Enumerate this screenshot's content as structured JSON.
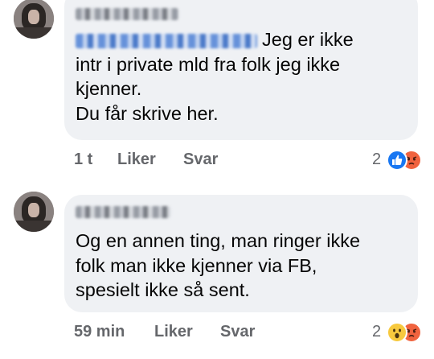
{
  "comments": [
    {
      "author": "Siv Stålberg",
      "mention": "Kaysh Anne Knestad",
      "lines": [
        "Jeg er ikke",
        "intr i private mld fra folk jeg ikke",
        "kjenner.",
        "Du får skrive her."
      ],
      "time": "1 t",
      "like_label": "Liker",
      "reply_label": "Svar",
      "reaction_count": "2",
      "reactions": [
        "like-icon",
        "angry-icon"
      ],
      "reaction_colors": {
        "like": "#1877f2",
        "angry": "#f0633f"
      }
    },
    {
      "author": "Siv Stålberg",
      "lines": [
        "Og en annen ting, man ringer ikke",
        "folk man ikke kjenner via FB,",
        "spesielt ikke så sent."
      ],
      "time": "59 min",
      "like_label": "Liker",
      "reply_label": "Svar",
      "reaction_count": "2",
      "reactions": [
        "wow-icon",
        "angry-icon"
      ],
      "reaction_colors": {
        "wow": "#f7c93e",
        "angry": "#f0633f"
      }
    }
  ]
}
